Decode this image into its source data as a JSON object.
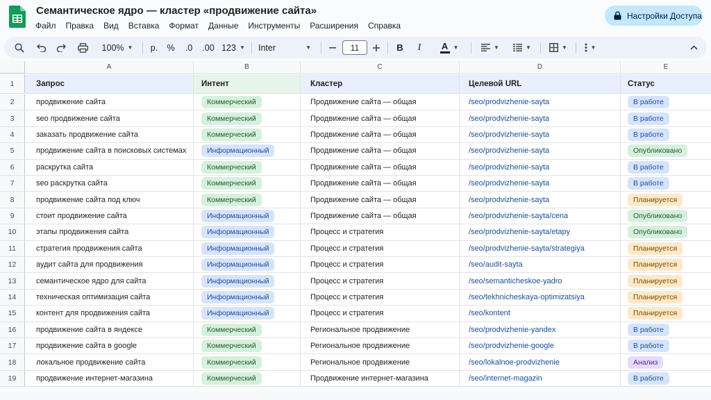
{
  "app": {
    "title": "Семантическое ядро — кластер «продвижение сайта»",
    "menu": [
      "Файл",
      "Правка",
      "Вид",
      "Вставка",
      "Формат",
      "Данные",
      "Инструменты",
      "Расширения",
      "Справка"
    ],
    "share_label": "Настройки Доступа",
    "brand_color": "#0f9d58",
    "accent_color": "#c2e7ff"
  },
  "toolbar": {
    "icons": [
      "search-icon",
      "undo-icon",
      "redo-icon",
      "print-icon"
    ],
    "zoom": "100%",
    "currency": "р.",
    "percent": "%",
    "decrease_decimals": ".0",
    "increase_decimals": ".00",
    "number_format": "123",
    "font": "Inter",
    "font_size": "11",
    "bold": "B",
    "italic": "I",
    "text_color": "A",
    "text_color_value": "#1f1f1f"
  },
  "columns": [
    "A",
    "B",
    "C",
    "D",
    "E"
  ],
  "header": {
    "row_num": "1",
    "cells": [
      "Запрос",
      "Интент",
      "Кластер",
      "Целевой URL",
      "Статус"
    ]
  },
  "rows": [
    {
      "num": "2",
      "query": "продвижение сайта",
      "intent": "Коммерческий",
      "cluster": "Продвижение сайта — общая",
      "url": "/seo/prodvizhenie-sayta",
      "status": "В работе"
    },
    {
      "num": "3",
      "query": "seo продвижение сайта",
      "intent": "Коммерческий",
      "cluster": "Продвижение сайта — общая",
      "url": "/seo/prodvizhenie-sayta",
      "status": "В работе"
    },
    {
      "num": "4",
      "query": "заказать продвижение сайта",
      "intent": "Коммерческий",
      "cluster": "Продвижение сайта — общая",
      "url": "/seo/prodvizhenie-sayta",
      "status": "В работе"
    },
    {
      "num": "5",
      "query": "продвижение сайта в поисковых системах",
      "intent": "Информационный",
      "cluster": "Продвижение сайта — общая",
      "url": "/seo/prodvizhenie-sayta",
      "status": "Опубликовано"
    },
    {
      "num": "6",
      "query": "раскрутка сайта",
      "intent": "Коммерческий",
      "cluster": "Продвижение сайта — общая",
      "url": "/seo/prodvizhenie-sayta",
      "status": "В работе"
    },
    {
      "num": "7",
      "query": "seo раскрутка сайта",
      "intent": "Коммерческий",
      "cluster": "Продвижение сайта — общая",
      "url": "/seo/prodvizhenie-sayta",
      "status": "В работе"
    },
    {
      "num": "8",
      "query": "продвижение сайта под ключ",
      "intent": "Коммерческий",
      "cluster": "Продвижение сайта — общая",
      "url": "/seo/prodvizhenie-sayta",
      "status": "Планируется"
    },
    {
      "num": "9",
      "query": "стоит продвижение сайта",
      "intent": "Информационный",
      "cluster": "Продвижение сайта — общая",
      "url": "/seo/prodvizhenie-sayta/cena",
      "status": "Опубликовано"
    },
    {
      "num": "10",
      "query": "этапы продвижения сайта",
      "intent": "Информационный",
      "cluster": "Процесс и стратегия",
      "url": "/seo/prodvizhenie-sayta/etapy",
      "status": "Опубликовано"
    },
    {
      "num": "11",
      "query": "стратегия продвижения сайта",
      "intent": "Информационный",
      "cluster": "Процесс и стратегия",
      "url": "/seo/prodvizhenie-sayta/strategiya",
      "status": "Планируется"
    },
    {
      "num": "12",
      "query": "аудит сайта для продвижения",
      "intent": "Информационный",
      "cluster": "Процесс и стратегия",
      "url": "/seo/audit-sayta",
      "status": "Планируется"
    },
    {
      "num": "13",
      "query": "семантическое ядро для сайта",
      "intent": "Информационный",
      "cluster": "Процесс и стратегия",
      "url": "/seo/semanticheskoe-yadro",
      "status": "Планируется"
    },
    {
      "num": "14",
      "query": "техническая оптимизация сайта",
      "intent": "Информационный",
      "cluster": "Процесс и стратегия",
      "url": "/seo/tekhnicheskaya-optimizatsiya",
      "status": "Планируется"
    },
    {
      "num": "15",
      "query": "контент для продвижения сайта",
      "intent": "Информационный",
      "cluster": "Процесс и стратегия",
      "url": "/seo/kontent",
      "status": "Планируется"
    },
    {
      "num": "16",
      "query": "продвижение сайта в яндексе",
      "intent": "Коммерческий",
      "cluster": "Региональное продвижение",
      "url": "/seo/prodvizhenie-yandex",
      "status": "В работе"
    },
    {
      "num": "17",
      "query": "продвижение сайта в google",
      "intent": "Коммерческий",
      "cluster": "Региональное продвижение",
      "url": "/seo/prodvizhenie-google",
      "status": "В работе"
    },
    {
      "num": "18",
      "query": "локальное продвижение сайта",
      "intent": "Коммерческий",
      "cluster": "Региональное продвижение",
      "url": "/seo/lokalnoe-prodvizhenie",
      "status": "Анализ"
    },
    {
      "num": "19",
      "query": "продвижение интернет-магазина",
      "intent": "Коммерческий",
      "cluster": "Продвижение интернет-магазина",
      "url": "/seo/internet-magazin",
      "status": "В работе"
    }
  ],
  "chip_colors": {
    "Коммерческий": "#d7f0dd",
    "Информационный": "#d6e4fb",
    "В работе": "#d6e4fb",
    "Опубликовано": "#d7f0dd",
    "Планируется": "#fde8c8",
    "Анализ": "#e6dcfa"
  }
}
